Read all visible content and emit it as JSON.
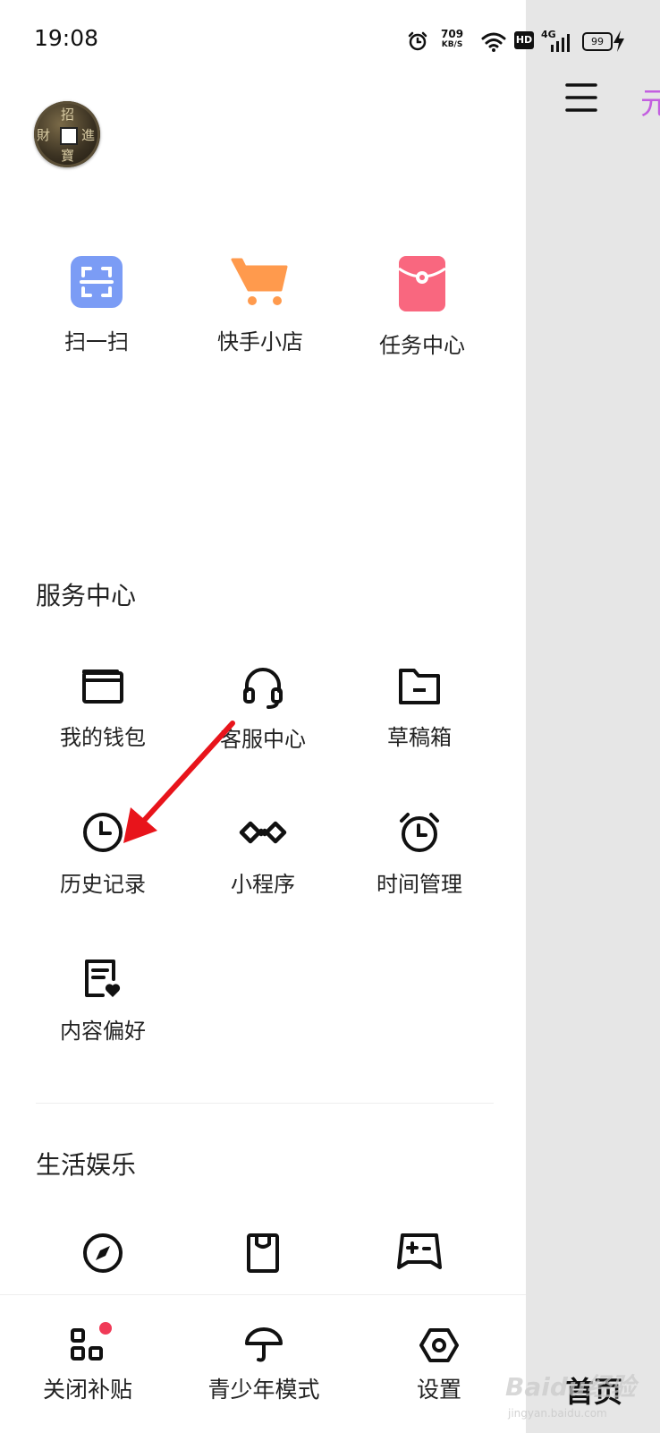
{
  "status_bar": {
    "time": "19:08",
    "speed_value": "709",
    "speed_unit": "KB/S",
    "hd": "HD",
    "network": "4G",
    "battery": "99"
  },
  "profile": {
    "avatar_chars": [
      "招",
      "財",
      "進",
      "寶"
    ]
  },
  "quick_actions": [
    {
      "label": "扫一扫",
      "icon": "scan-icon",
      "color": "#7b9cf5"
    },
    {
      "label": "快手小店",
      "icon": "cart-icon",
      "color": "#ff9a4d"
    },
    {
      "label": "任务中心",
      "icon": "red-packet-icon",
      "color": "#f9677f"
    }
  ],
  "service_center": {
    "title": "服务中心",
    "items": [
      {
        "label": "我的钱包",
        "icon": "wallet-icon"
      },
      {
        "label": "客服中心",
        "icon": "headset-icon"
      },
      {
        "label": "草稿箱",
        "icon": "folder-icon"
      },
      {
        "label": "历史记录",
        "icon": "clock-icon"
      },
      {
        "label": "小程序",
        "icon": "mini-program-icon"
      },
      {
        "label": "时间管理",
        "icon": "alarm-icon"
      },
      {
        "label": "内容偏好",
        "icon": "preference-icon"
      }
    ]
  },
  "life_entertainment": {
    "title": "生活娱乐",
    "items": [
      {
        "icon": "compass-icon"
      },
      {
        "icon": "card-icon"
      },
      {
        "icon": "gamepad-icon"
      }
    ]
  },
  "bottom_bar": [
    {
      "label": "关闭补贴",
      "icon": "apps-icon",
      "badge": true
    },
    {
      "label": "青少年模式",
      "icon": "umbrella-icon"
    },
    {
      "label": "设置",
      "icon": "settings-icon"
    }
  ],
  "right_panel": {
    "tab_partial": "元",
    "home_label": "首页"
  },
  "watermark": {
    "text": "Baidu经验",
    "url_text": "jingyan.baidu.com"
  },
  "colors": {
    "arrow": "#e8141b",
    "accent": "#c35fe0"
  }
}
